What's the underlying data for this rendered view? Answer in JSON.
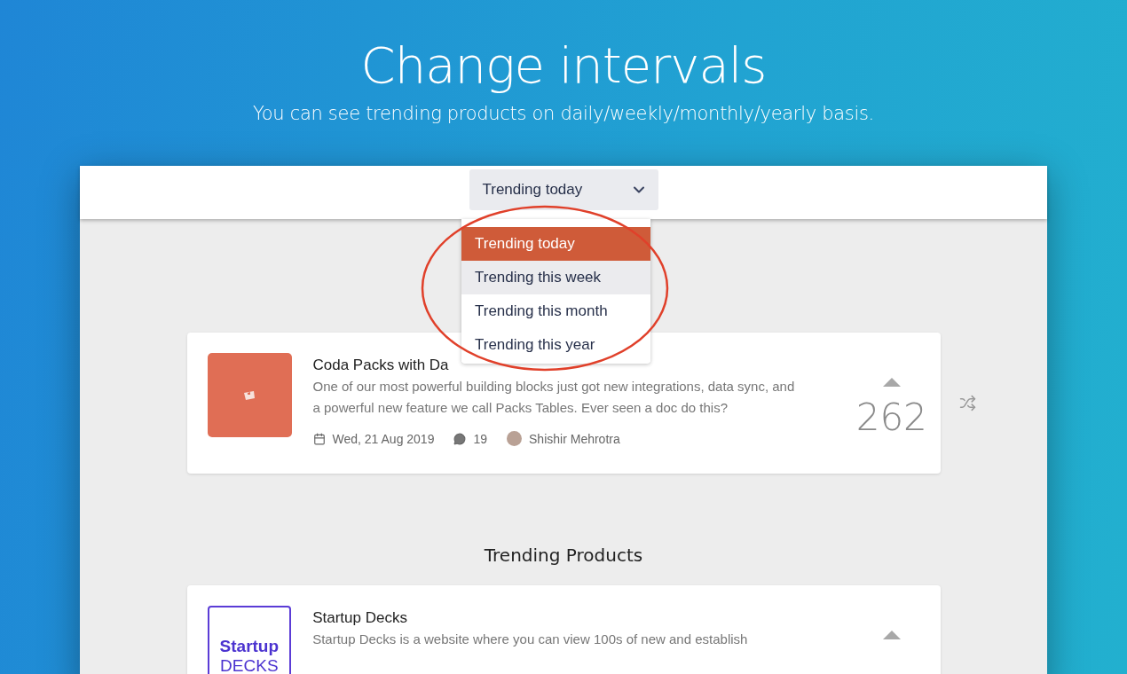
{
  "hero": {
    "title": "Change intervals",
    "subtitle": "You can see trending products on daily/weekly/monthly/yearly basis."
  },
  "interval_select": {
    "value": "Trending today",
    "expanded": true,
    "options": [
      {
        "label": "Trending today",
        "selected": true,
        "hovered": false
      },
      {
        "label": "Trending this week",
        "selected": false,
        "hovered": true
      },
      {
        "label": "Trending this month",
        "selected": false,
        "hovered": false
      },
      {
        "label": "Trending this year",
        "selected": false,
        "hovered": false
      }
    ]
  },
  "featured": {
    "title": "Coda Packs with Da",
    "description": "One of our most powerful building blocks just got new integrations, data sync, and a powerful new feature we call Packs Tables. Ever seen a doc do this?",
    "date": "Wed, 21 Aug 2019",
    "comments": "19",
    "author": "Shishir Mehrotra",
    "votes": "262"
  },
  "section_title": "Trending Products",
  "products": [
    {
      "title": "Startup Decks",
      "logo_line_1": "Startup",
      "logo_line_2": "DECKS",
      "description": "Startup Decks is a website where you can view 100s of new and establish"
    }
  ]
}
